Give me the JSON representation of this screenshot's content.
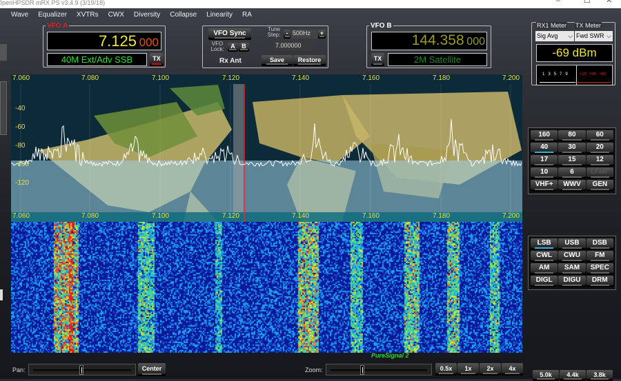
{
  "window": {
    "title": "OpenHPSDR mRX PS v3.4.9 (3/19/18)",
    "minimize": "–",
    "maximize": "☐",
    "close": "✕"
  },
  "menu": [
    "Wave",
    "Equalizer",
    "XVTRs",
    "CWX",
    "Diversity",
    "Collapse",
    "Linearity",
    "RA"
  ],
  "vfo_a": {
    "label": "VFO A",
    "freq_main": "7.125",
    "freq_sub": "000",
    "band_text": "40M Ext/Adv SSB",
    "tx": "TX"
  },
  "center": {
    "vfo_sync": "VFO Sync",
    "tune_step_label": "Tune Step:",
    "tune_minus": "-",
    "tune_step": "500Hz",
    "tune_plus": "+",
    "vfo_lock_label": "VFO Lock:",
    "lock_a": "A",
    "lock_b": "B",
    "freq_entry": "7.000000",
    "rx_ant": "Rx Ant",
    "save": "Save",
    "restore": "Restore"
  },
  "vfo_b": {
    "label": "VFO B",
    "freq_main": "144.358",
    "freq_sub": "000",
    "band_text": "2M Satellite",
    "tx": "TX"
  },
  "meter": {
    "rx_label": "RX1 Meter",
    "tx_label": "TX Meter",
    "rx_select": "Sig Avg",
    "tx_select": "Fwd SWR",
    "reading": "-69 dBm",
    "scale_white": [
      "1",
      "3",
      "5",
      "7",
      "9"
    ],
    "scale_red": [
      "+20",
      "+40",
      "+60"
    ]
  },
  "spectrum": {
    "freq_ticks": [
      "7.060",
      "7.080",
      "7.100",
      "7.120",
      "7.140",
      "7.160",
      "7.180",
      "7.200"
    ],
    "db_ticks": [
      "-40",
      "-60",
      "-80",
      "-100",
      "-120"
    ],
    "bottom_ticks": [
      "7.060",
      "7.080",
      "7.100",
      "7.120",
      "7.140",
      "7.160",
      "7.180",
      "7.200"
    ],
    "vfo_line_color": "#ff2020"
  },
  "bands": [
    {
      "label": "160"
    },
    {
      "label": "80"
    },
    {
      "label": "60"
    },
    {
      "label": "40",
      "selected": true
    },
    {
      "label": "30"
    },
    {
      "label": "20"
    },
    {
      "label": "17"
    },
    {
      "label": "15"
    },
    {
      "label": "12"
    },
    {
      "label": "10"
    },
    {
      "label": "6"
    },
    {
      "label": "LFMF",
      "disabled": true
    },
    {
      "label": "VHF+"
    },
    {
      "label": "WWV"
    },
    {
      "label": "GEN"
    }
  ],
  "modes": [
    {
      "label": "LSB",
      "selected": true
    },
    {
      "label": "USB"
    },
    {
      "label": "DSB"
    },
    {
      "label": "CWL"
    },
    {
      "label": "CWU"
    },
    {
      "label": "FM"
    },
    {
      "label": "AM"
    },
    {
      "label": "SAM"
    },
    {
      "label": "SPEC"
    },
    {
      "label": "DIGL"
    },
    {
      "label": "DIGU"
    },
    {
      "label": "DRM"
    }
  ],
  "bottom": {
    "puresignal": "PureSignal 2",
    "pan_label": "Pan:",
    "center": "Center",
    "zoom_label": "Zoom:",
    "zoom_buttons": [
      "0.5x",
      "1x",
      "2x",
      "4x"
    ],
    "filter_buttons": [
      "5.0k",
      "4.4k",
      "3.8k"
    ],
    "pan_value": 0.5,
    "zoom_value": 0.2
  }
}
